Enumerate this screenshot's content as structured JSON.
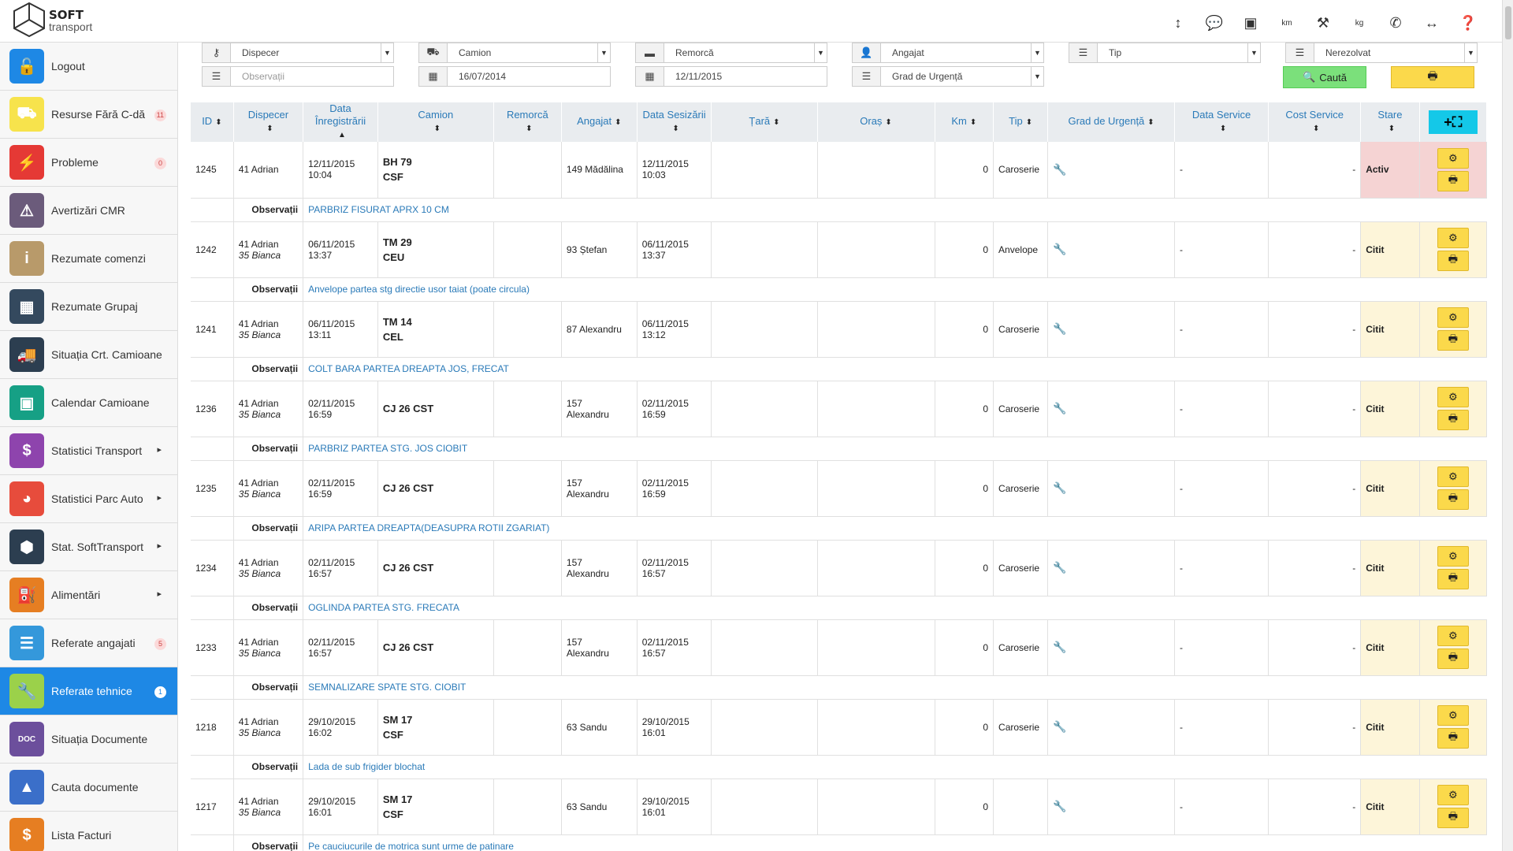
{
  "app": {
    "logo_line1": "SOFT",
    "logo_line2": "transport",
    "accent": "#1e88e5"
  },
  "topbar_icons": [
    "resize-vertical-icon",
    "chat-icon",
    "contact-card-icon",
    "km-icon",
    "tools-icon",
    "weight-kg-icon",
    "phone-icon",
    "resize-horizontal-icon",
    "help-icon"
  ],
  "sidebar": {
    "items": [
      {
        "label": "Logout",
        "icon": "logout-icon",
        "color": "#1e88e5",
        "glyph": "🔓",
        "badge": "",
        "arrow": false
      },
      {
        "label": "Resurse Fără C-dă",
        "icon": "resources-icon",
        "color": "#f7e34c",
        "glyph": "⛟",
        "badge": "11",
        "arrow": false
      },
      {
        "label": "Probleme",
        "icon": "problems-icon",
        "color": "#e53935",
        "glyph": "⚡",
        "badge": "0",
        "arrow": false
      },
      {
        "label": "Avertizări CMR",
        "icon": "warning-icon",
        "color": "#6b5b7b",
        "glyph": "⚠",
        "badge": "",
        "arrow": false
      },
      {
        "label": "Rezumate comenzi",
        "icon": "info-diamond-icon",
        "color": "#b89a6a",
        "glyph": "i",
        "badge": "",
        "arrow": false
      },
      {
        "label": "Rezumate Grupaj",
        "icon": "grid-icon",
        "color": "#34495e",
        "glyph": "▦",
        "badge": "",
        "arrow": false
      },
      {
        "label": "Situația Crt. Camioane",
        "icon": "truck-icon",
        "color": "#2c3e50",
        "glyph": "🚚",
        "badge": "",
        "arrow": false
      },
      {
        "label": "Calendar Camioane",
        "icon": "calendar-icon",
        "color": "#16a085",
        "glyph": "▣",
        "badge": "",
        "arrow": false
      },
      {
        "label": "Statistici Transport",
        "icon": "chart-bars-icon",
        "color": "#8e44ad",
        "glyph": "$",
        "badge": "",
        "arrow": true
      },
      {
        "label": "Statistici Parc Auto",
        "icon": "pie-chart-icon",
        "color": "#e74c3c",
        "glyph": "◕",
        "badge": "",
        "arrow": true
      },
      {
        "label": "Stat. SoftTransport",
        "icon": "hexagon-icon",
        "color": "#2c3e50",
        "glyph": "⬢",
        "badge": "",
        "arrow": true
      },
      {
        "label": "Alimentări",
        "icon": "fuel-icon",
        "color": "#e67e22",
        "glyph": "⛽",
        "badge": "",
        "arrow": true
      },
      {
        "label": "Referate angajati",
        "icon": "document-list-icon",
        "color": "#3498db",
        "glyph": "☰",
        "badge": "5",
        "arrow": false
      },
      {
        "label": "Referate tehnice",
        "icon": "wrench-icon",
        "color": "#9bd14a",
        "glyph": "🔧",
        "badge": "1",
        "arrow": false,
        "active": true
      },
      {
        "label": "Situația Documente",
        "icon": "doc-icon",
        "color": "#6c4f9c",
        "glyph": "DOC",
        "badge": "",
        "arrow": false
      },
      {
        "label": "Cauta documente",
        "icon": "drive-icon",
        "color": "#3b6fc9",
        "glyph": "▲",
        "badge": "",
        "arrow": false
      },
      {
        "label": "Lista Facturi",
        "icon": "invoice-icon",
        "color": "#e67e22",
        "glyph": "$",
        "badge": "",
        "arrow": false
      }
    ]
  },
  "filters": {
    "dispecer": "Dispecer",
    "observatii_placeholder": "Observații",
    "camion": "Camion",
    "date_from": "16/07/2014",
    "remorca": "Remorcă",
    "date_to": "12/11/2015",
    "angajat": "Angajat",
    "grad_urgenta": "Grad de Urgență",
    "tip": "Tip",
    "stare": "Nerezolvat",
    "search_label": "Caută",
    "print_label": "🖶"
  },
  "table": {
    "headers": [
      "ID",
      "Dispecer",
      "Data Înregistrării",
      "Camion",
      "Remorcă",
      "Angajat",
      "Data Sesizării",
      "Țară",
      "Oraș",
      "Km",
      "Tip",
      "Grad de Urgență",
      "Data Service",
      "Cost Service",
      "Stare"
    ],
    "obs_label": "Observații",
    "rows": [
      {
        "id": "1245",
        "disp1": "41 Adrian",
        "disp2": "",
        "data_inreg": "12/11/2015 10:04",
        "camion1": "BH 79",
        "camion2": "CSF",
        "remorca": "",
        "angajat1": "149 Mădălina",
        "angajat2": "",
        "data_ses": "12/11/2015 10:03",
        "tara": "",
        "oras": "",
        "km": "0",
        "tip": "Caroserie",
        "data_service": "-",
        "cost_service": "-",
        "stare": "Activ",
        "active": true,
        "obs": "PARBRIZ FISURAT APRX 10 CM"
      },
      {
        "id": "1242",
        "disp1": "41 Adrian",
        "disp2": "35 Bianca",
        "data_inreg": "06/11/2015 13:37",
        "camion1": "TM 29",
        "camion2": "CEU",
        "remorca": "",
        "angajat1": "93 Ștefan",
        "angajat2": "",
        "data_ses": "06/11/2015 13:37",
        "tara": "",
        "oras": "",
        "km": "0",
        "tip": "Anvelope",
        "data_service": "-",
        "cost_service": "-",
        "stare": "Citit",
        "active": false,
        "obs": "Anvelope partea stg directie usor taiat (poate circula)"
      },
      {
        "id": "1241",
        "disp1": "41 Adrian",
        "disp2": "35 Bianca",
        "data_inreg": "06/11/2015 13:11",
        "camion1": "TM 14",
        "camion2": "CEL",
        "remorca": "",
        "angajat1": "87 Alexandru",
        "angajat2": "",
        "data_ses": "06/11/2015 13:12",
        "tara": "",
        "oras": "",
        "km": "0",
        "tip": "Caroserie",
        "data_service": "-",
        "cost_service": "-",
        "stare": "Citit",
        "active": false,
        "obs": "COLT BARA PARTEA DREAPTA JOS, FRECAT"
      },
      {
        "id": "1236",
        "disp1": "41 Adrian",
        "disp2": "35 Bianca",
        "data_inreg": "02/11/2015 16:59",
        "camion1": "CJ 26 CST",
        "camion2": "",
        "remorca": "",
        "angajat1": "157",
        "angajat2": "Alexandru",
        "data_ses": "02/11/2015 16:59",
        "tara": "",
        "oras": "",
        "km": "0",
        "tip": "Caroserie",
        "data_service": "-",
        "cost_service": "-",
        "stare": "Citit",
        "active": false,
        "obs": "PARBRIZ PARTEA STG. JOS CIOBIT"
      },
      {
        "id": "1235",
        "disp1": "41 Adrian",
        "disp2": "35 Bianca",
        "data_inreg": "02/11/2015 16:59",
        "camion1": "CJ 26 CST",
        "camion2": "",
        "remorca": "",
        "angajat1": "157",
        "angajat2": "Alexandru",
        "data_ses": "02/11/2015 16:59",
        "tara": "",
        "oras": "",
        "km": "0",
        "tip": "Caroserie",
        "data_service": "-",
        "cost_service": "-",
        "stare": "Citit",
        "active": false,
        "obs": "ARIPA PARTEA DREAPTA(DEASUPRA ROTII ZGARIAT)"
      },
      {
        "id": "1234",
        "disp1": "41 Adrian",
        "disp2": "35 Bianca",
        "data_inreg": "02/11/2015 16:57",
        "camion1": "CJ 26 CST",
        "camion2": "",
        "remorca": "",
        "angajat1": "157",
        "angajat2": "Alexandru",
        "data_ses": "02/11/2015 16:57",
        "tara": "",
        "oras": "",
        "km": "0",
        "tip": "Caroserie",
        "data_service": "-",
        "cost_service": "-",
        "stare": "Citit",
        "active": false,
        "obs": "OGLINDA PARTEA STG. FRECATA"
      },
      {
        "id": "1233",
        "disp1": "41 Adrian",
        "disp2": "35 Bianca",
        "data_inreg": "02/11/2015 16:57",
        "camion1": "CJ 26 CST",
        "camion2": "",
        "remorca": "",
        "angajat1": "157",
        "angajat2": "Alexandru",
        "data_ses": "02/11/2015 16:57",
        "tara": "",
        "oras": "",
        "km": "0",
        "tip": "Caroserie",
        "data_service": "-",
        "cost_service": "-",
        "stare": "Citit",
        "active": false,
        "obs": "SEMNALIZARE SPATE STG. CIOBIT"
      },
      {
        "id": "1218",
        "disp1": "41 Adrian",
        "disp2": "35 Bianca",
        "data_inreg": "29/10/2015 16:02",
        "camion1": "SM 17",
        "camion2": "CSF",
        "remorca": "",
        "angajat1": "63 Sandu",
        "angajat2": "",
        "data_ses": "29/10/2015 16:01",
        "tara": "",
        "oras": "",
        "km": "0",
        "tip": "Caroserie",
        "data_service": "-",
        "cost_service": "-",
        "stare": "Citit",
        "active": false,
        "obs": "Lada de sub frigider blochat"
      },
      {
        "id": "1217",
        "disp1": "41 Adrian",
        "disp2": "35 Bianca",
        "data_inreg": "29/10/2015 16:01",
        "camion1": "SM 17",
        "camion2": "CSF",
        "remorca": "",
        "angajat1": "63 Sandu",
        "angajat2": "",
        "data_ses": "29/10/2015 16:01",
        "tara": "",
        "oras": "",
        "km": "0",
        "tip": "",
        "data_service": "-",
        "cost_service": "-",
        "stare": "Citit",
        "active": false,
        "obs": "Pe cauciucurile de motrica sunt urme de patinare"
      }
    ]
  }
}
